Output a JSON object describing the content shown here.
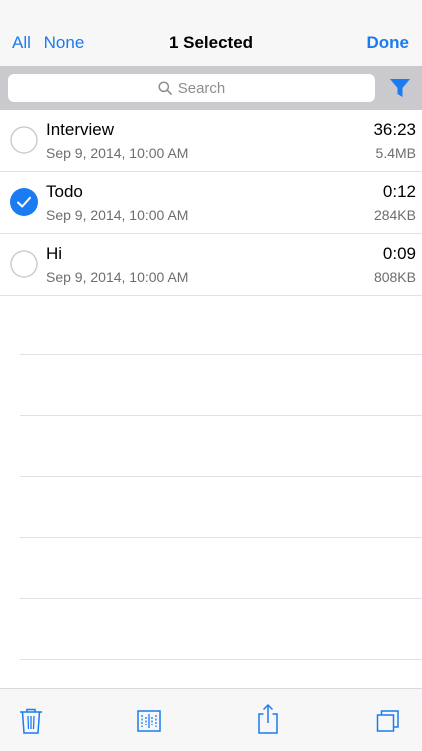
{
  "navbar": {
    "all_label": "All",
    "none_label": "None",
    "title": "1 Selected",
    "done_label": "Done"
  },
  "search": {
    "placeholder": "Search"
  },
  "icons": {
    "search": "magnifier-icon",
    "filter": "filter-icon",
    "delete": "trash-icon",
    "edit": "waveform-edit-icon",
    "share": "share-icon",
    "duplicate": "duplicate-icon"
  },
  "colors": {
    "accent": "#1a7cf0"
  },
  "recordings": [
    {
      "name": "Interview",
      "date": "Sep 9, 2014, 10:00 AM",
      "duration": "36:23",
      "size": "5.4MB",
      "selected": false
    },
    {
      "name": "Todo",
      "date": "Sep 9, 2014, 10:00 AM",
      "duration": "0:12",
      "size": "284KB",
      "selected": true
    },
    {
      "name": "Hi",
      "date": "Sep 9, 2014, 10:00 AM",
      "duration": "0:09",
      "size": "808KB",
      "selected": false
    }
  ]
}
